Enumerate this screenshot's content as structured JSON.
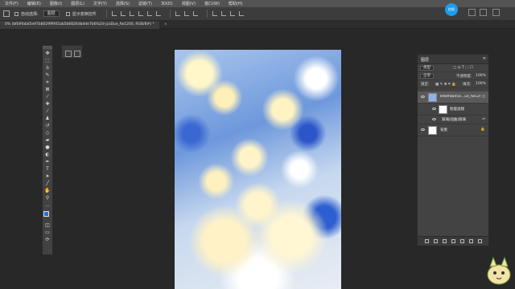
{
  "menu": [
    "文件(F)",
    "编辑(E)",
    "图像(I)",
    "图层(L)",
    "文字(Y)",
    "选择(S)",
    "滤镜(T)",
    "3D(D)",
    "视图(V)",
    "窗口(W)",
    "帮助(H)"
  ],
  "options": {
    "auto_select": "自动选择:",
    "layer_dropdown": "图层",
    "show_transform": "显示变换控件"
  },
  "avatar_text": "拍照",
  "document": {
    "tab_title": "0% (bfb9fabd5e97b8029f9f45ab5b6826dbdde7b6fa2d-jzaDue_fw1200, RGB/8#) *",
    "close": "×"
  },
  "layers_panel": {
    "title": "图层",
    "kind_filter": "类型",
    "blend_mode": "正常",
    "opacity_label": "不透明度:",
    "opacity": "100%",
    "lock_label": "锁定:",
    "fill_label": "填充:",
    "fill": "100%",
    "layers": [
      {
        "name": "bfb9fabd5e...ue_fw1200",
        "selected": true
      },
      {
        "name": "智能滤镜",
        "selected": false
      },
      {
        "name": "玻璃|扭曲|玻璃",
        "selected": false
      },
      {
        "name": "背景",
        "selected": false
      }
    ]
  },
  "colors": {
    "foreground": "#2a6fd6",
    "background": "#ffffff",
    "avatar": "#1e9be9"
  }
}
